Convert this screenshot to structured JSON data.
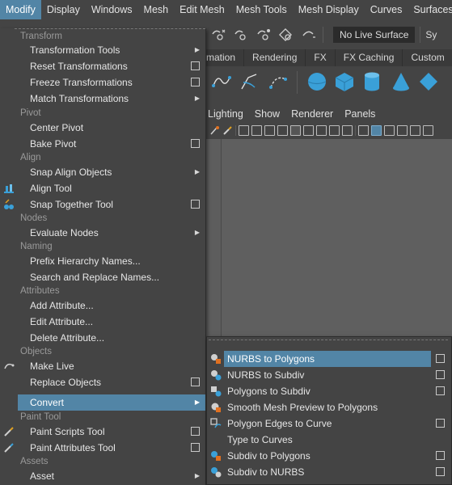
{
  "menubar": {
    "items": [
      "Modify",
      "Display",
      "Windows",
      "Mesh",
      "Edit Mesh",
      "Mesh Tools",
      "Mesh Display",
      "Curves",
      "Surfaces"
    ],
    "active_index": 0
  },
  "status_line": {
    "live_surface": "No Live Surface",
    "symmetry_partial": "Sy"
  },
  "shelf_tabs": [
    "mation",
    "Rendering",
    "FX",
    "FX Caching",
    "Custom"
  ],
  "panel_menus": [
    "Lighting",
    "Show",
    "Renderer",
    "Panels"
  ],
  "modify_menu": {
    "sections": {
      "transform": "Transform",
      "pivot": "Pivot",
      "align": "Align",
      "nodes": "Nodes",
      "naming": "Naming",
      "attributes": "Attributes",
      "objects": "Objects",
      "paint_tool": "Paint Tool",
      "assets": "Assets"
    },
    "items": {
      "transformation_tools": "Transformation Tools",
      "reset_transformations": "Reset Transformations",
      "freeze_transformations": "Freeze Transformations",
      "match_transformations": "Match Transformations",
      "center_pivot": "Center Pivot",
      "bake_pivot": "Bake Pivot",
      "snap_align_objects": "Snap Align Objects",
      "align_tool": "Align Tool",
      "snap_together_tool": "Snap Together Tool",
      "evaluate_nodes": "Evaluate Nodes",
      "prefix_hierarchy_names": "Prefix Hierarchy Names...",
      "search_replace_names": "Search and Replace Names...",
      "add_attribute": "Add Attribute...",
      "edit_attribute": "Edit Attribute...",
      "delete_attribute": "Delete Attribute...",
      "make_live": "Make Live",
      "replace_objects": "Replace Objects",
      "convert": "Convert",
      "paint_scripts_tool": "Paint Scripts Tool",
      "paint_attributes_tool": "Paint Attributes Tool",
      "asset": "Asset"
    }
  },
  "convert_submenu": {
    "items": {
      "nurbs_to_polygons": "NURBS to Polygons",
      "nurbs_to_subdiv": "NURBS to Subdiv",
      "polygons_to_subdiv": "Polygons to Subdiv",
      "smooth_mesh_preview": "Smooth Mesh Preview to Polygons",
      "polygon_edges_to_curve": "Polygon Edges to Curve",
      "type_to_curves": "Type to Curves",
      "subdiv_to_polygons": "Subdiv to Polygons",
      "subdiv_to_nurbs": "Subdiv to NURBS"
    }
  },
  "colors": {
    "highlight": "#5285a6",
    "menu_bg": "#444444",
    "section_text": "#9a9a9a",
    "shelf_icon_blue": "#3aa0d8"
  },
  "icons": {
    "submenu_arrow": "triangle-right-icon",
    "option_box": "option-box-icon"
  }
}
